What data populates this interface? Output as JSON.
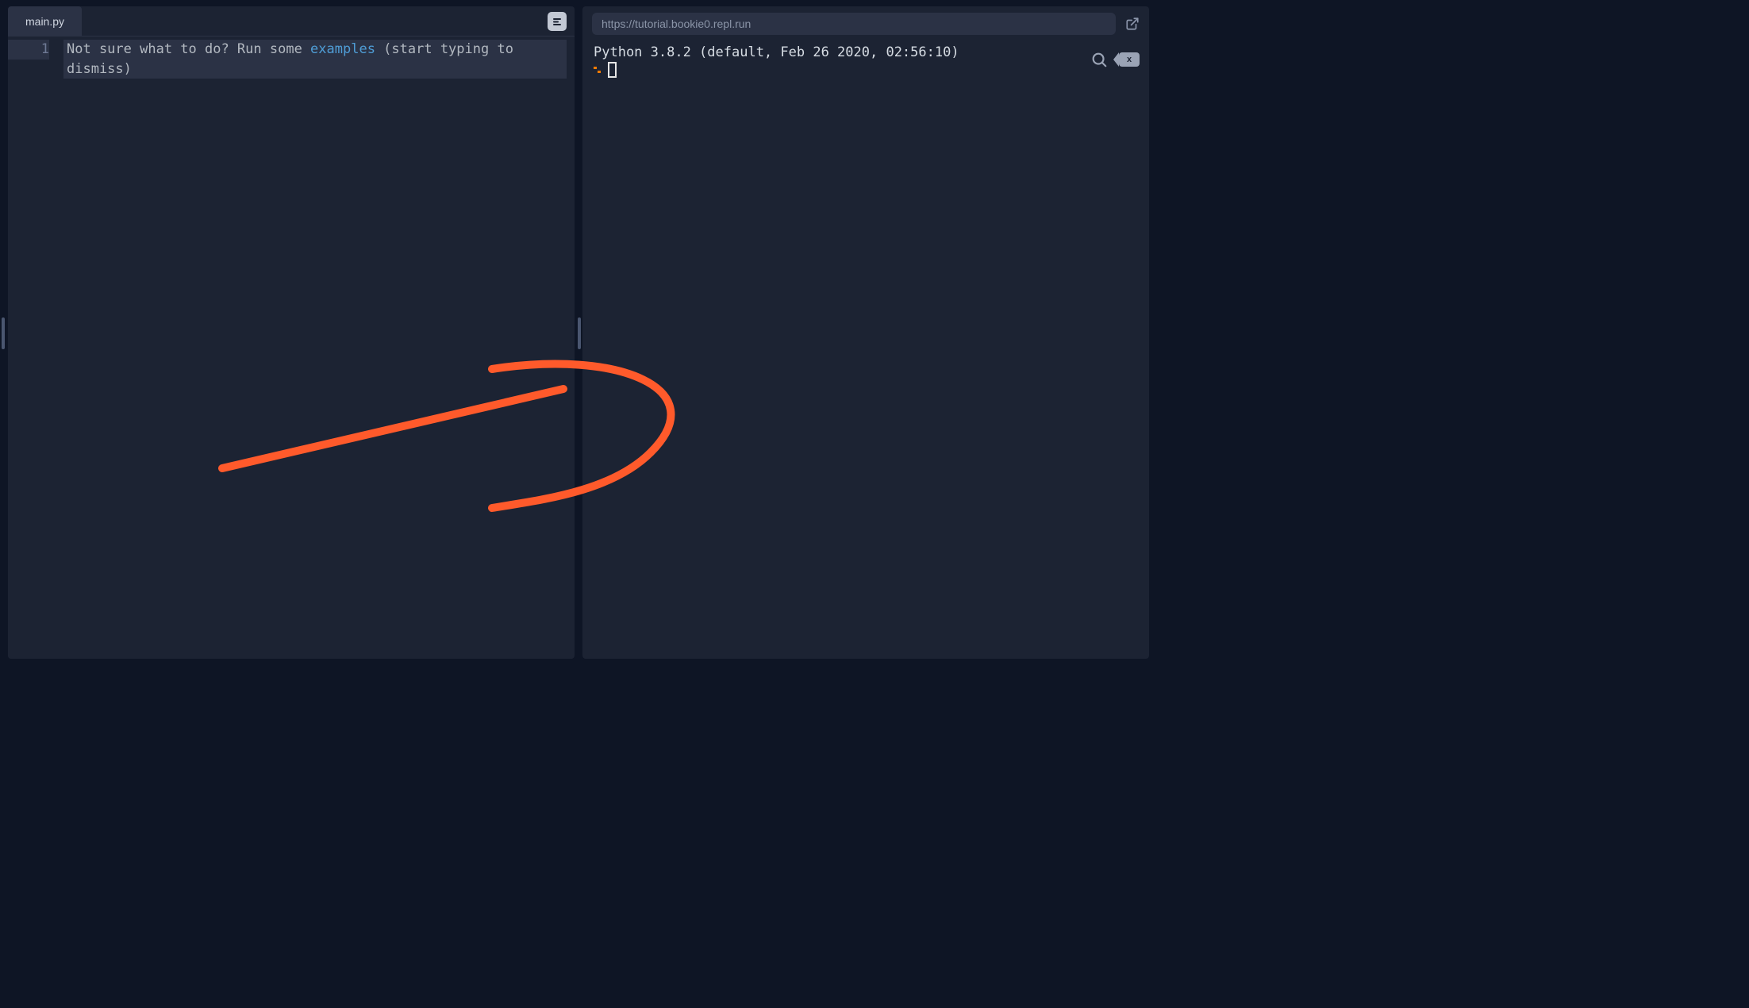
{
  "editor": {
    "tab_label": "main.py",
    "line_number": "1",
    "placeholder_prefix": "Not sure what to do? Run some ",
    "placeholder_link": "examples",
    "placeholder_suffix": " (start typing to dismiss)"
  },
  "console": {
    "url": "https://tutorial.bookie0.repl.run",
    "banner": "Python 3.8.2 (default, Feb 26 2020, 02:56:10)",
    "prompt_symbol": "",
    "backspace_label": "x"
  },
  "colors": {
    "accent_orange": "#ff5a2b",
    "link_blue": "#4f9dd6",
    "bg_dark": "#0e1525",
    "panel": "#1c2333"
  }
}
